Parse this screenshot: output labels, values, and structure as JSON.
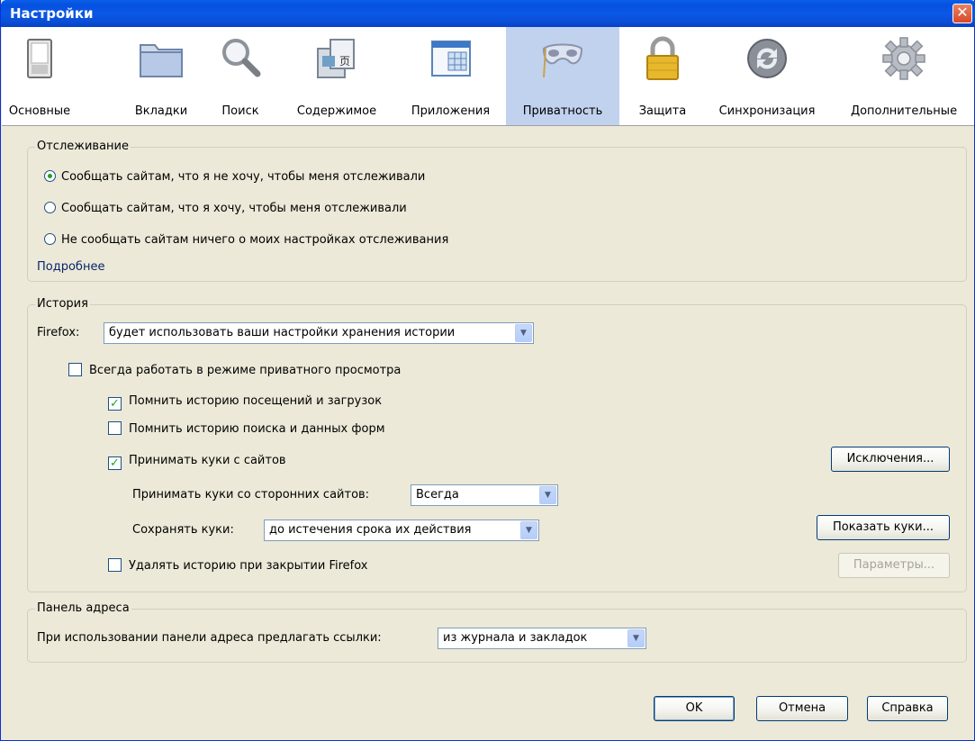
{
  "window": {
    "title": "Настройки",
    "close": "✕"
  },
  "toolbar": {
    "tabs": [
      {
        "label": "Основные",
        "icon": "switch-icon",
        "selected": false
      },
      {
        "label": "Вкладки",
        "icon": "folder-icon",
        "selected": false
      },
      {
        "label": "Поиск",
        "icon": "magnifier-icon",
        "selected": false
      },
      {
        "label": "Содержимое",
        "icon": "content-icon",
        "selected": false
      },
      {
        "label": "Приложения",
        "icon": "applications-icon",
        "selected": false
      },
      {
        "label": "Приватность",
        "icon": "mask-icon",
        "selected": true
      },
      {
        "label": "Защита",
        "icon": "padlock-icon",
        "selected": false
      },
      {
        "label": "Синхронизация",
        "icon": "sync-icon",
        "selected": false
      },
      {
        "label": "Дополнительные",
        "icon": "gear-icon",
        "selected": false
      }
    ]
  },
  "tracking": {
    "title": "Отслеживание",
    "options": [
      {
        "label": "Сообщать сайтам, что я не хочу, чтобы меня отслеживали",
        "checked": true
      },
      {
        "label": "Сообщать сайтам, что я хочу, чтобы меня отслеживали",
        "checked": false
      },
      {
        "label": "Не сообщать сайтам ничего о моих настройках отслеживания",
        "checked": false
      }
    ],
    "more_link": "Подробнее"
  },
  "history": {
    "title": "История",
    "firefox_label": "Firefox:",
    "mode_value": "будет использовать ваши настройки хранения истории",
    "private_mode": {
      "label": "Всегда работать в режиме приватного просмотра",
      "checked": false
    },
    "remember_history": {
      "label": "Помнить историю посещений и загрузок",
      "checked": true
    },
    "remember_search": {
      "label": "Помнить историю поиска и данных форм",
      "checked": false
    },
    "accept_cookies": {
      "label": "Принимать куки с сайтов",
      "checked": true
    },
    "exceptions_button": "Исключения...",
    "third_party_label": "Принимать куки со сторонних сайтов:",
    "third_party_value": "Всегда",
    "keep_label": "Сохранять куки:",
    "keep_value": "до истечения срока их действия",
    "show_cookies_button": "Показать куки...",
    "clear_on_close": {
      "label": "Удалять историю при закрытии Firefox",
      "checked": false
    },
    "settings_button": "Параметры..."
  },
  "address_bar": {
    "title": "Панель адреса",
    "suggest_label": "При использовании панели адреса предлагать ссылки:",
    "suggest_value": "из журнала и закладок"
  },
  "footer": {
    "ok": "OK",
    "cancel": "Отмена",
    "help": "Справка"
  },
  "colors": {
    "title_bar": "#0a5fe8",
    "selected_tab": "#c1d2ee",
    "dialog_bg": "#ece9d8",
    "link": "#0a246a"
  }
}
